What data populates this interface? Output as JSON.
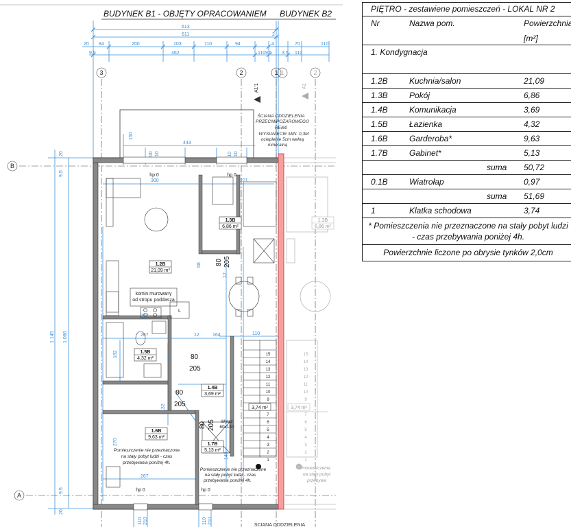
{
  "plan": {
    "title_b1": "BUDYNEK B1 - OBJĘTY OPRACOWANIEM",
    "title_b2": "BUDYNEK B2",
    "axes": {
      "a3": "3",
      "a2": "2",
      "a1": "1",
      "b1": "1",
      "b2": "2",
      "B": "B",
      "A": "A"
    },
    "section_mark": "A1'1",
    "section_mark_b2": "A1",
    "dims_top": {
      "d613": "613",
      "d611": "611",
      "d2": "2",
      "d20": "20",
      "d84": "84",
      "d200": "200",
      "d103": "103",
      "d110": "110",
      "d94": "94",
      "d4": "4",
      "d9_5": "9,5",
      "d462": "462",
      "d110b": "110",
      "d9_5b": "9.5",
      "d70": "70",
      "d3_5": "3.5",
      "d110c": "110",
      "d110d": "110"
    },
    "dims_other": {
      "d150": "150",
      "d443": "443",
      "d200": "200",
      "d210": "210",
      "d110": "110",
      "d210b": "210",
      "d20": "20",
      "d9_5": "9,5",
      "d300": "300",
      "d221": "221",
      "d267": "267",
      "d12": "12",
      "d164": "164",
      "d110b": "110",
      "d1145": "1.145",
      "d1086": "1.086",
      "d182": "182",
      "d132": "132",
      "d20b": "20",
      "d9_5b": "9,5",
      "d270": "270",
      "d267b": "267",
      "d110c": "110",
      "d210c": "210",
      "d110d": "110",
      "d210d": "210",
      "d148": "148",
      "d247": "247",
      "d12b": "12",
      "d68": "68",
      "d90": "90"
    },
    "hp0": "hp 0",
    "wall_note": [
      "ŚCIANA ODDZIELENIA",
      "PRZECIWPOŻAROWEGO",
      "REI60",
      "WYSUNIĘCIE MIN. 0,3M",
      "ocieplenie 5cm wełną",
      "mineralną"
    ],
    "wall_note_bottom": "ŚCIANA ODDZIELENIA",
    "chimney": [
      "komin murowany",
      "od stropu poddasza"
    ],
    "stove_label": "L",
    "rooms": [
      {
        "code": "1.2B",
        "area": "21,09 m²"
      },
      {
        "code": "1.3B",
        "area": "6,86 m²"
      },
      {
        "code": "1.4B",
        "area": "3,69 m²"
      },
      {
        "code": "1.5B",
        "area": "4,32 m²"
      },
      {
        "code": "1.6B",
        "area": "9,63 m²"
      },
      {
        "code": "1.7B",
        "area": "5,13 m²"
      },
      {
        "code": "",
        "area": "3,74 m²"
      },
      {
        "code": "1.3B",
        "area": "6,86 m²"
      },
      {
        "code": "",
        "area": "3,74 m²"
      }
    ],
    "door_80": "80",
    "door_205": "205",
    "hatch": [
      "Wyłaz",
      "60x140"
    ],
    "attic_note": [
      "Pomieszczenie nie przeznaczone",
      "na stały pobyt ludzi - czas",
      "przebywania poniżej 4h."
    ],
    "attic_note2": [
      "Pomieszczenie nie przeznaczone",
      "na stały pobyt ludzi - czas",
      "przebywania poniżej 4h."
    ],
    "attic_note3": [
      "Pomieszczenia",
      "na stały pobyt",
      "przebywa"
    ],
    "stair_nums": [
      "15",
      "14",
      "13",
      "12",
      "11",
      "10",
      "9",
      "8",
      "7",
      "6",
      "5",
      "4",
      "3",
      "2",
      "1"
    ],
    "stair_nums_b2": [
      "15",
      "14",
      "13",
      "12",
      "11",
      "10",
      "9",
      "8",
      "7",
      "6",
      "5",
      "4",
      "3",
      "2",
      "1"
    ]
  },
  "table": {
    "title": "PIĘTRO -  zestawiene pomieszczeń - LOKAL NR 2",
    "h_nr": "Nr",
    "h_name": "Nazwa pom.",
    "h_area": "Powierzchnia",
    "h_unit": "[m²]",
    "group": "1. Kondygnacja",
    "rows": [
      {
        "nr": "1.2B",
        "name": "Kuchnia/salon",
        "area": "21,09"
      },
      {
        "nr": "1.3B",
        "name": "Pokój",
        "area": "6,86"
      },
      {
        "nr": "1.4B",
        "name": "Komunikacja",
        "area": "3,69"
      },
      {
        "nr": "1.5B",
        "name": "Łazienka",
        "area": "4,32"
      },
      {
        "nr": "1.6B",
        "name": "Garderoba*",
        "area": "9,63"
      },
      {
        "nr": "1.7B",
        "name": "Gabinet*",
        "area": "5,13"
      }
    ],
    "sum1_label": "suma",
    "sum1": "50,72",
    "extra_nr": "0.1B",
    "extra_name": "Wiatrołap",
    "extra_area": "0,97",
    "sum2_label": "suma",
    "sum2": "51,69",
    "stair_nr": "1",
    "stair_name": "Klatka schodowa",
    "stair_area": "3,74",
    "note1": "* Pomieszczenia nie przeznaczone na stały pobyt ludzi",
    "note2": "- czas przebywania poniżej 4h.",
    "footer": "Powierzchnie liczone po obrysie tynków 2,0cm"
  }
}
